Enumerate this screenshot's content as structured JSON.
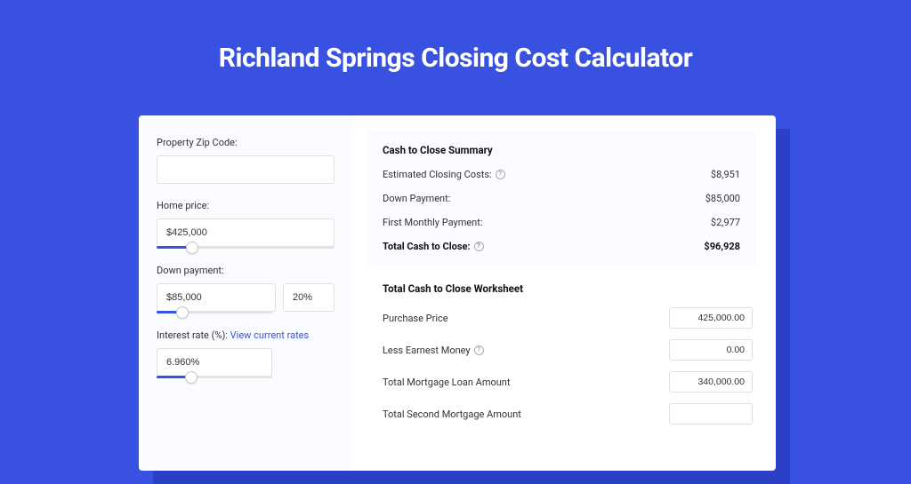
{
  "title": "Richland Springs Closing Cost Calculator",
  "sidebar": {
    "zip": {
      "label": "Property Zip Code:",
      "value": ""
    },
    "homePrice": {
      "label": "Home price:",
      "value": "$425,000",
      "fillPct": 20
    },
    "downPayment": {
      "label": "Down payment:",
      "value": "$85,000",
      "pct": "20%",
      "fillPct": 22
    },
    "interest": {
      "label": "Interest rate (%): ",
      "link": "View current rates",
      "value": "6.960%",
      "fillPct": 30
    }
  },
  "summary": {
    "title": "Cash to Close Summary",
    "rows": [
      {
        "label": "Estimated Closing Costs:",
        "icon": true,
        "value": "$8,951"
      },
      {
        "label": "Down Payment:",
        "icon": false,
        "value": "$85,000"
      },
      {
        "label": "First Monthly Payment:",
        "icon": false,
        "value": "$2,977"
      }
    ],
    "total": {
      "label": "Total Cash to Close:",
      "icon": true,
      "value": "$96,928"
    }
  },
  "worksheet": {
    "title": "Total Cash to Close Worksheet",
    "rows": [
      {
        "label": "Purchase Price",
        "icon": false,
        "value": "425,000.00"
      },
      {
        "label": "Less Earnest Money",
        "icon": true,
        "value": "0.00"
      },
      {
        "label": "Total Mortgage Loan Amount",
        "icon": false,
        "value": "340,000.00"
      },
      {
        "label": "Total Second Mortgage Amount",
        "icon": false,
        "value": ""
      }
    ]
  }
}
